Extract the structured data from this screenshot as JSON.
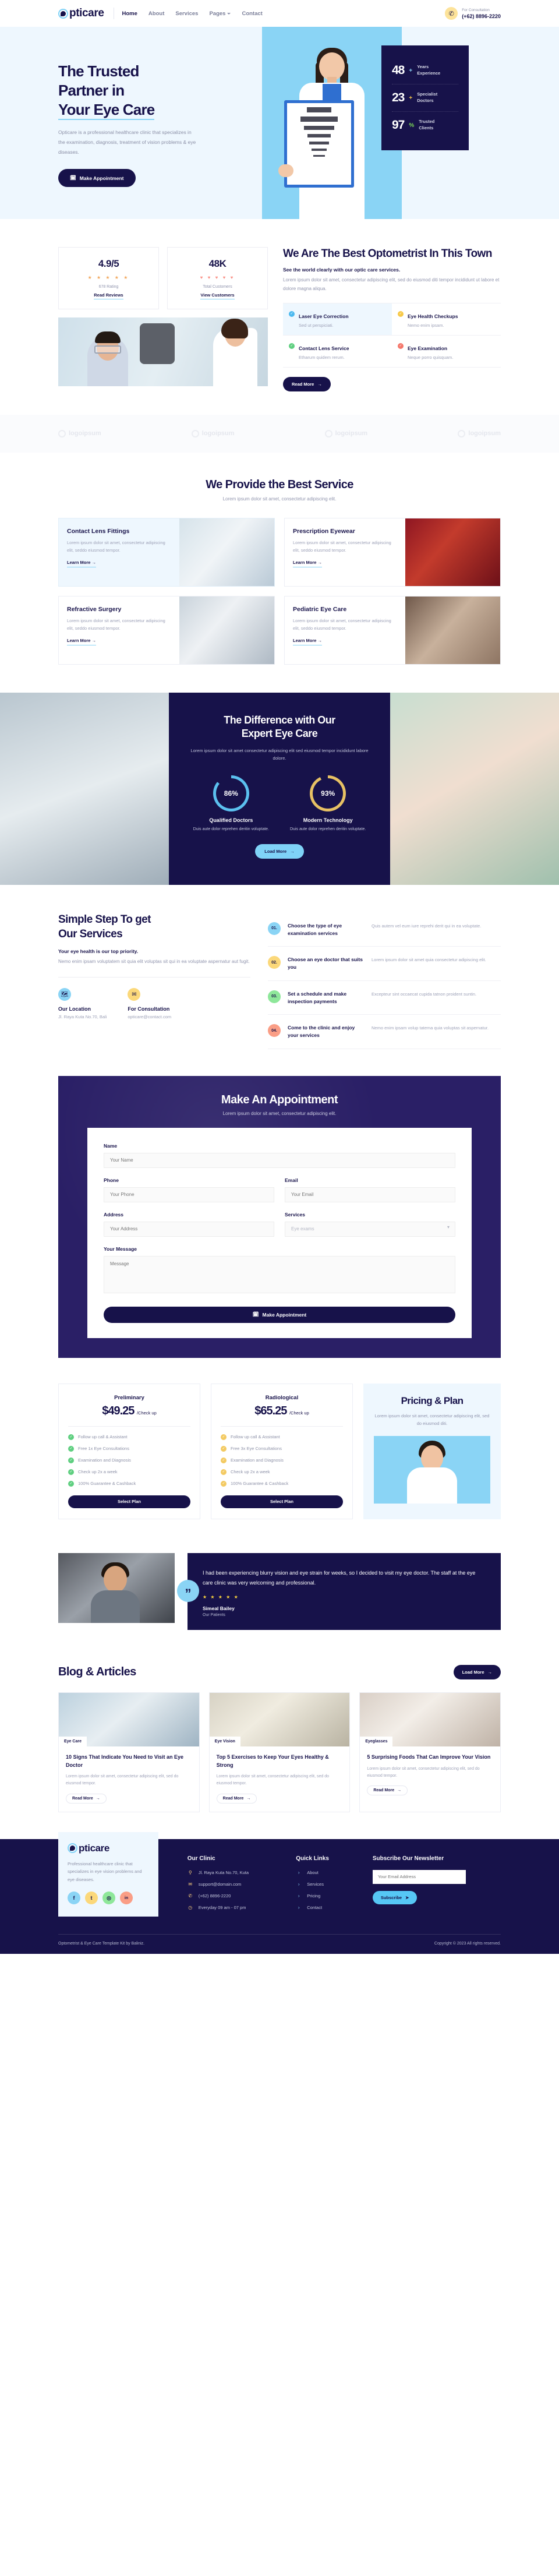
{
  "brand": {
    "name": "pticare",
    "logo_icon": "eye-logo-icon"
  },
  "header": {
    "nav": [
      {
        "label": "Home",
        "active": true
      },
      {
        "label": "About",
        "active": false
      },
      {
        "label": "Services",
        "active": false
      },
      {
        "label": "Pages",
        "active": false,
        "has_caret": true
      },
      {
        "label": "Contact",
        "active": false
      }
    ],
    "consultation_label": "For Consultation",
    "phone": "(+62) 8896-2220",
    "phone_icon": "phone-icon"
  },
  "hero": {
    "title_line1": "The Trusted",
    "title_line2": "Partner in",
    "title_line3": "Your Eye Care",
    "paragraph": "Opticare is a professional healthcare clinic that specializes in the examination, diagnosis, treatment of vision problems & eye diseases.",
    "cta": "Make Appointment",
    "cta_icon": "calendar-icon",
    "stats": [
      {
        "value": "48",
        "suffix": "+",
        "suffix_color": "#8ad4f5",
        "label_line1": "Years",
        "label_line2": "Experience"
      },
      {
        "value": "23",
        "suffix": "+",
        "suffix_color": "#f7c948",
        "label_line1": "Specialist",
        "label_line2": "Doctors"
      },
      {
        "value": "97",
        "suffix": "%",
        "suffix_color": "#7ed957",
        "label_line1": "Trusted",
        "label_line2": "Clients"
      }
    ]
  },
  "about": {
    "kpis": [
      {
        "value": "4.9/5",
        "icons": "★ ★ ★ ★ ★",
        "icon_color": "#f2a65a",
        "sub": "678 Rating",
        "link": "Read Reviews"
      },
      {
        "value": "48K",
        "icons": "♥ ♥ ♥ ♥ ♥",
        "icon_color": "#fa9389",
        "sub": "Total Customers",
        "link": "View Customers"
      }
    ],
    "heading": "We Are The Best Optometrist In This Town",
    "lead": "See the world clearly with our optic care services.",
    "body": "Lorem ipsum dolor sit amet, consectetur adipiscing elit, sed do eiusmod diti tempor incididunt ut labore et dolore magna aliqua.",
    "features": [
      {
        "title": "Laser Eye Correction",
        "desc": "Sed ut perspiciati.",
        "color": "#4cb9ef",
        "highlight": true
      },
      {
        "title": "Eye Health Checkups",
        "desc": "Nemo enim ipsam.",
        "color": "#f7c948",
        "highlight": false
      },
      {
        "title": "Contact Lens Service",
        "desc": "Etharum quidem rerum.",
        "color": "#5fcf80",
        "highlight": false
      },
      {
        "title": "Eye Examination",
        "desc": "Neque porro quisquam.",
        "color": "#f5776b",
        "highlight": false
      }
    ],
    "cta": "Read More",
    "cta_icon": "arrow-right-icon"
  },
  "clients": [
    {
      "name": "logoipsum"
    },
    {
      "name": "logoipsum"
    },
    {
      "name": "logoipsum"
    },
    {
      "name": "logoipsum"
    }
  ],
  "services": {
    "heading": "We Provide the Best Service",
    "sub": "Lorem ipsum dolor sit amet, consectetur adipiscing elit.",
    "link_label": "Learn More",
    "link_icon": "arrow-right-icon",
    "items": [
      {
        "title": "Contact Lens Fittings",
        "desc": "Lorem ipsum dolor sit amet, consectetur adipiscing elit, seddo eiusmod tempor.",
        "highlight": true
      },
      {
        "title": "Prescription Eyewear",
        "desc": "Lorem ipsum dolor sit amet, consectetur adipiscing elit, seddo eiusmod tempor.",
        "highlight": false
      },
      {
        "title": "Refractive Surgery",
        "desc": "Lorem ipsum dolor sit amet, consectetur adipiscing elit, seddo eiusmod tempor.",
        "highlight": false
      },
      {
        "title": "Pediatric Eye Care",
        "desc": "Lorem ipsum dolor sit amet, consectetur adipiscing elit, seddo eiusmod tempor.",
        "highlight": false
      }
    ]
  },
  "difference": {
    "title_line1": "The Difference with Our",
    "title_line2": "Expert Eye Care",
    "sub": "Lorem ipsum dolor sit amet consectetur adipiscing elit sed eiusmod tempor incididunt labore dolore.",
    "cta": "Load More",
    "cta_icon": "arrow-right-icon",
    "rings": [
      {
        "percent": "86%",
        "value": 86,
        "color": "#5bc0ef",
        "name": "Qualified Doctors",
        "desc": "Duis aute dolor reprehen deritin voluptate."
      },
      {
        "percent": "93%",
        "value": 93,
        "color": "#e7c164",
        "name": "Modern Technology",
        "desc": "Duis aute dolor reprehen deritin voluptate."
      }
    ]
  },
  "steps_section": {
    "heading_line1": "Simple Step To get",
    "heading_line2": "Our Services",
    "lead": "Your eye health is our top priority.",
    "body": "Nemo enim ipsam voluptatem sit quia elit voluptas sit qui in ea voluptate aspernatur aut fugit.",
    "contacts": [
      {
        "icon": "map-icon",
        "bg": "#8ad4f5",
        "title": "Our Location",
        "detail": "Jl. Raya Kuta No.70, Bali"
      },
      {
        "icon": "mail-icon",
        "bg": "#fbd87a",
        "title": "For Consultation",
        "detail": "opticare@contact.com"
      }
    ],
    "steps": [
      {
        "num": "01.",
        "color": "#8ad4f5",
        "title": "Choose the type of eye examination services",
        "desc": "Quis autem vel eum iure reprehi derit qui in ea voluptate."
      },
      {
        "num": "02.",
        "color": "#fbd87a",
        "title": "Choose an eye doctor that suits you",
        "desc": "Lorem ipsum dolor sit amet quia consectetur adipiscing elit."
      },
      {
        "num": "03.",
        "color": "#8ee79a",
        "title": "Set a schedule and make inspection payments",
        "desc": "Excepteur sint occaecat cupida tatnon proident suntin."
      },
      {
        "num": "04.",
        "color": "#fa9e86",
        "title": "Come to the clinic and enjoy your services",
        "desc": "Nemo enim ipsam volup tatema quia voluptas sit aspernatur."
      }
    ]
  },
  "appointment": {
    "heading": "Make An Appointment",
    "sub": "Lorem ipsum dolor sit amet, consectetur adipiscing elit.",
    "fields": {
      "name_label": "Name",
      "name_placeholder": "Your Name",
      "phone_label": "Phone",
      "phone_placeholder": "Your Phone",
      "email_label": "Email",
      "email_placeholder": "Your Email",
      "address_label": "Address",
      "address_placeholder": "Your Address",
      "services_label": "Services",
      "services_value": "Eye exams",
      "message_label": "Your Message",
      "message_placeholder": "Message"
    },
    "submit": "Make Appointment",
    "submit_icon": "calendar-icon"
  },
  "pricing": {
    "aside_heading": "Pricing & Plan",
    "aside_text": "Lorem ipsum dolor sit amet, consectetur adipiscing elit, sed do eiusmod diti.",
    "select_label": "Select Plan",
    "plans": [
      {
        "name": "Preliminary",
        "price": "$49.25",
        "per": "/Check up",
        "color": "#5fcf80",
        "features": [
          "Follow up call & Assistant",
          "Free 1x Eye Consultations",
          "Examination and Diagnosis",
          "Check up 2x a week",
          "100% Guarantee & Cashback"
        ]
      },
      {
        "name": "Radiological",
        "price": "$65.25",
        "per": "/Check up",
        "color": "#f3ca62",
        "features": [
          "Follow up call & Assistant",
          "Free 3x Eye Consultations",
          "Examination and Diagnosis",
          "Check up 2x a week",
          "100% Guarantee & Cashback"
        ]
      }
    ]
  },
  "testimonial": {
    "quote": "I had been experiencing blurry vision and eye strain for weeks, so I decided to visit my eye doctor. The staff at the eye care clinic was very welcoming and professional.",
    "stars": "★ ★ ★ ★ ★",
    "name": "Simeal Bailey",
    "role": "Our Patients",
    "quote_icon": "quote-icon"
  },
  "blog": {
    "heading": "Blog & Articles",
    "cta": "Load More",
    "cta_icon": "arrow-right-icon",
    "read_more": "Read More",
    "posts": [
      {
        "tag": "Eye Care",
        "title": "10 Signs That Indicate You Need to Visit an Eye Doctor",
        "desc": "Lorem ipsum dolor sit amet, consectetur adipiscing elit, sed do eiusmod tempor."
      },
      {
        "tag": "Eye Vision",
        "title": "Top 5 Exercises to Keep Your Eyes Healthy & Strong",
        "desc": "Lorem ipsum dolor sit amet, consectetur adipiscing elit, sed do eiusmod tempor."
      },
      {
        "tag": "Eyeglasses",
        "title": "5 Surprising Foods That Can Improve Your Vision",
        "desc": "Lorem ipsum dolor sit amet, consectetur adipiscing elit, sed do eiusmod tempor."
      }
    ]
  },
  "footer": {
    "about": "Professional healthcare clinic that specializes in eye vision problems and eye diseases.",
    "socials": [
      {
        "icon": "facebook-icon",
        "glyph": "f",
        "bg": "#8ad4f5"
      },
      {
        "icon": "twitter-icon",
        "glyph": "t",
        "bg": "#fbd87a"
      },
      {
        "icon": "instagram-icon",
        "glyph": "◎",
        "bg": "#8ee79a"
      },
      {
        "icon": "linkedin-icon",
        "glyph": "in",
        "bg": "#fa9e86"
      }
    ],
    "clinic_title": "Our Clinic",
    "clinic": [
      {
        "icon": "location-pin-icon",
        "glyph": "⚲",
        "text": "Jl. Raya Kuta No.70, Kuta"
      },
      {
        "icon": "envelope-icon",
        "glyph": "✉",
        "text": "support@domain.com"
      },
      {
        "icon": "phone-icon",
        "glyph": "✆",
        "text": "(+62) 8896-2220"
      },
      {
        "icon": "clock-icon",
        "glyph": "◷",
        "text": "Everyday 09 am - 07 pm"
      }
    ],
    "links_title": "Quick Links",
    "links": [
      "About",
      "Services",
      "Pricing",
      "Contact"
    ],
    "newsletter_title": "Subscribe Our Newsletter",
    "newsletter_placeholder": "Your Email Address",
    "subscribe": "Subscribe",
    "subscribe_icon": "send-icon",
    "credit": "Optometrist & Eye Care Template Kit by Baliniz.",
    "copyright": "Copyright © 2023 All rights reserved."
  }
}
